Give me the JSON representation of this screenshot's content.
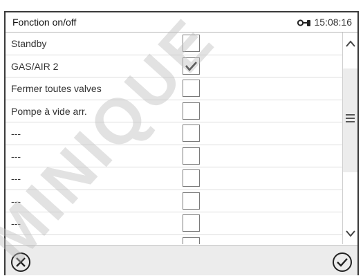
{
  "header": {
    "title": "Fonction on/off",
    "time": "15:08:16",
    "lock_icon": "key-lock-icon"
  },
  "rows": [
    {
      "label": "Standby",
      "checked": false
    },
    {
      "label": "GAS/AIR 2",
      "checked": true
    },
    {
      "label": "Fermer toutes valves",
      "checked": false
    },
    {
      "label": "Pompe à vide arr.",
      "checked": false
    },
    {
      "label": "---",
      "checked": false
    },
    {
      "label": "---",
      "checked": false
    },
    {
      "label": "---",
      "checked": false
    },
    {
      "label": "---",
      "checked": false
    },
    {
      "label": "---",
      "checked": false
    },
    {
      "label": "",
      "checked": false
    }
  ],
  "scrollbar": {
    "up_icon": "chevron-up-icon",
    "handle_icon": "menu-lines-icon",
    "down_icon": "chevron-down-icon"
  },
  "footer": {
    "cancel_icon": "cancel-circle-icon",
    "confirm_icon": "confirm-circle-icon"
  },
  "watermark": "MINIQUE",
  "colors": {
    "border": "#3a3a3a",
    "footer_bg": "#ececec",
    "checkbox_border": "#7a7a7a"
  }
}
